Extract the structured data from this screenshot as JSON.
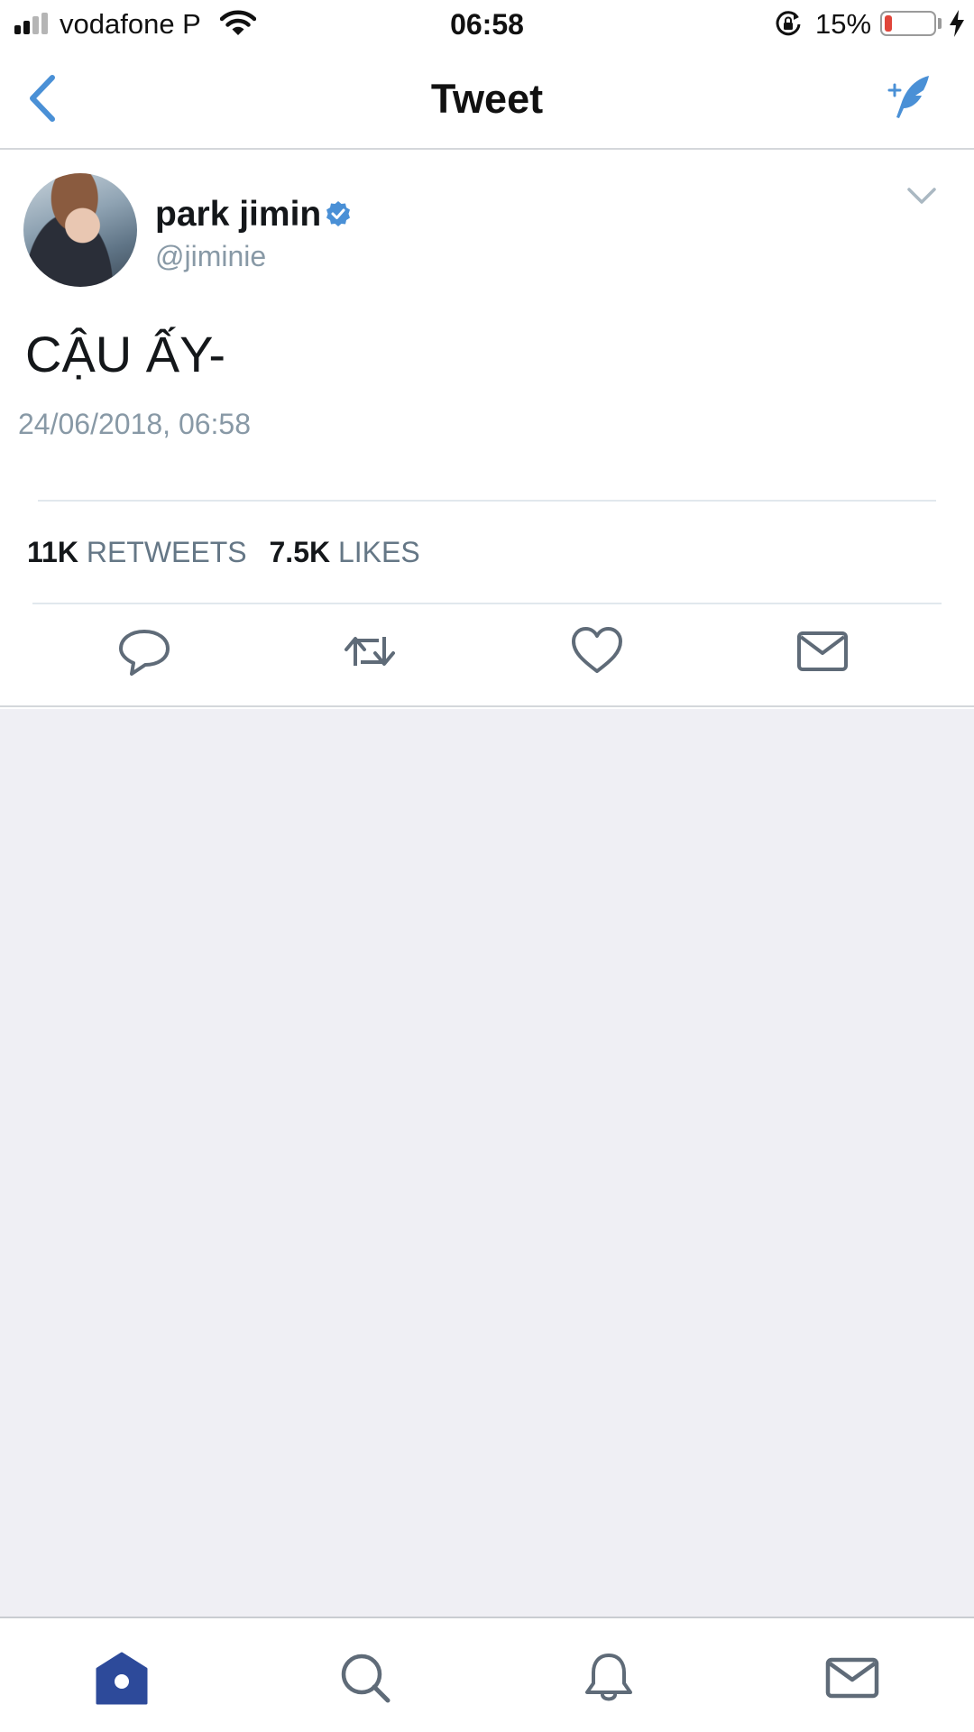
{
  "status_bar": {
    "carrier": "vodafone P",
    "time": "06:58",
    "battery_percent_label": "15%",
    "battery_level": 0.15,
    "signal_bars_filled": 2,
    "signal_bars_total": 4
  },
  "nav": {
    "title": "Tweet",
    "back_icon": "chevron-left-icon",
    "compose_icon": "compose-tweet-icon"
  },
  "tweet": {
    "display_name": "park jimin",
    "verified": true,
    "username": "@jiminie",
    "text": "CẬU ẤY-",
    "timestamp": "24/06/2018, 06:58",
    "retweets_count": "11K",
    "retweets_label": "RETWEETS",
    "likes_count": "7.5K",
    "likes_label": "LIKES",
    "actions": [
      "reply-icon",
      "retweet-icon",
      "like-icon",
      "direct-message-icon"
    ]
  },
  "tab_bar": {
    "tabs": [
      "home-icon",
      "search-icon",
      "notifications-icon",
      "messages-icon"
    ],
    "active": "home"
  },
  "colors": {
    "accent_blue": "#4a90d6",
    "home_active": "#2d4a9a",
    "icon_gray": "#5f6b78",
    "battery_low": "#e0453a",
    "text_secondary": "#8899a6",
    "empty_background": "#efeff4"
  }
}
